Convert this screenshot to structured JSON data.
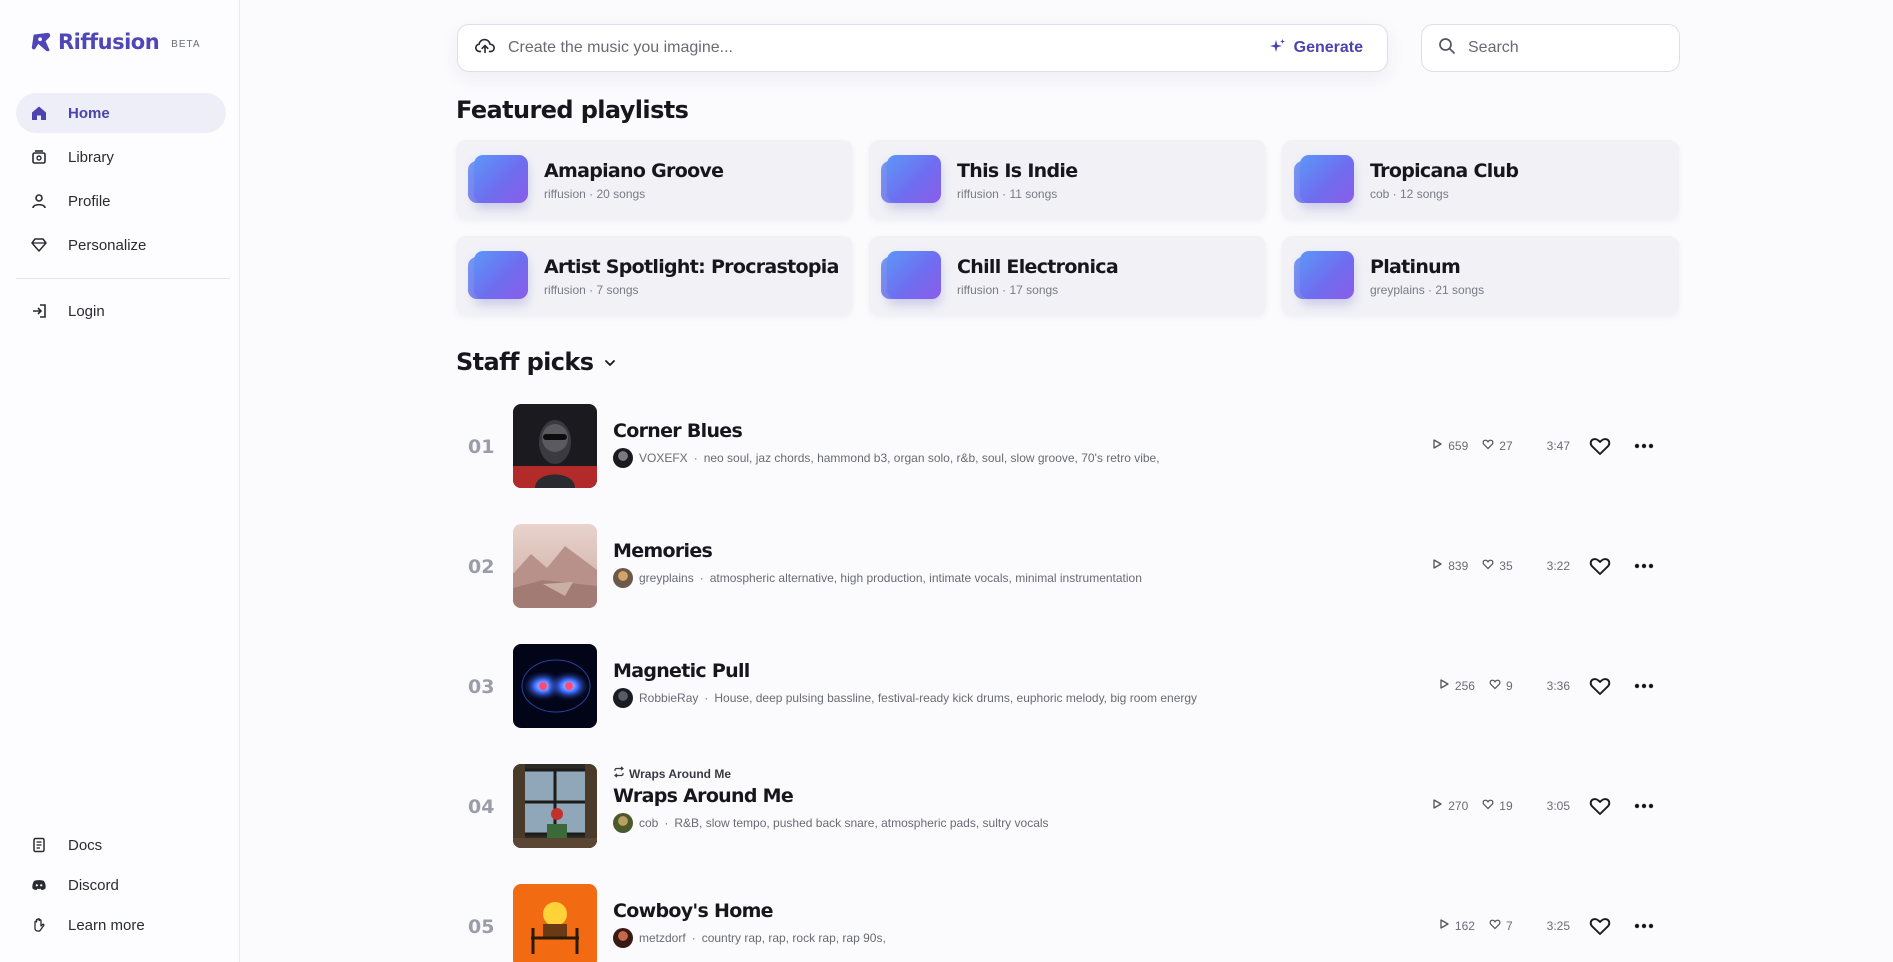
{
  "app": {
    "name": "Riffusion",
    "badge": "BETA",
    "brand_color": "#4f46b8"
  },
  "sidebar": {
    "items": [
      {
        "label": "Home",
        "icon": "home-icon",
        "active": true
      },
      {
        "label": "Library",
        "icon": "library-icon"
      },
      {
        "label": "Profile",
        "icon": "user-icon"
      },
      {
        "label": "Personalize",
        "icon": "diamond-icon"
      }
    ],
    "login": {
      "label": "Login",
      "icon": "login-icon"
    },
    "bottom": [
      {
        "label": "Docs",
        "icon": "document-icon"
      },
      {
        "label": "Discord",
        "icon": "discord-icon"
      },
      {
        "label": "Learn more",
        "icon": "hand-wave-icon"
      }
    ]
  },
  "prompt": {
    "placeholder": "Create the music you imagine...",
    "generate_label": "Generate"
  },
  "search": {
    "placeholder": "Search"
  },
  "featured": {
    "title": "Featured playlists",
    "playlists": [
      {
        "name": "Amapiano Groove",
        "meta": "riffusion · 20 songs"
      },
      {
        "name": "This Is Indie",
        "meta": "riffusion · 11 songs"
      },
      {
        "name": "Tropicana Club",
        "meta": "cob · 12 songs"
      },
      {
        "name": "Artist Spotlight: Procrastopia",
        "meta": "riffusion · 7 songs"
      },
      {
        "name": "Chill Electronica",
        "meta": "riffusion · 17 songs"
      },
      {
        "name": "Platinum",
        "meta": "greyplains · 21 songs"
      }
    ]
  },
  "staff_picks": {
    "title": "Staff picks",
    "tracks": [
      {
        "num": "01",
        "title": "Corner Blues",
        "artist": "VOXEFX",
        "tags": "neo soul, jaz chords, hammond b3, organ solo, r&b, soul, slow groove, 70's retro vibe,",
        "plays": "659",
        "likes": "27",
        "duration": "3:47"
      },
      {
        "num": "02",
        "title": "Memories",
        "artist": "greyplains",
        "tags": "atmospheric alternative, high production, intimate vocals, minimal instrumentation",
        "plays": "839",
        "likes": "35",
        "duration": "3:22"
      },
      {
        "num": "03",
        "title": "Magnetic Pull",
        "artist": "RobbieRay",
        "tags": "House, deep pulsing bassline, festival-ready kick drums, euphoric melody, big room energy",
        "plays": "256",
        "likes": "9",
        "duration": "3:36"
      },
      {
        "num": "04",
        "title": "Wraps Around Me",
        "remix_of": "Wraps Around Me",
        "artist": "cob",
        "tags": "R&B, slow tempo, pushed back snare, atmospheric pads, sultry vocals",
        "plays": "270",
        "likes": "19",
        "duration": "3:05"
      },
      {
        "num": "05",
        "title": "Cowboy's Home",
        "artist": "metzdorf",
        "tags": "country rap, rap, rock rap, rap 90s,",
        "plays": "162",
        "likes": "7",
        "duration": "3:25"
      }
    ]
  }
}
